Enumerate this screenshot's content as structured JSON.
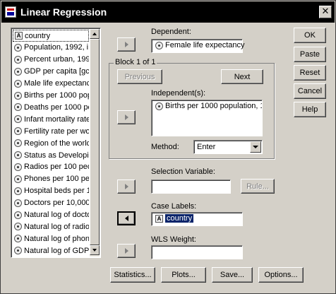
{
  "window": {
    "title": "Linear Regression",
    "close_glyph": "✕"
  },
  "variables": [
    {
      "label": "country",
      "type": "string"
    },
    {
      "label": "Population, 1992, i",
      "type": "scale"
    },
    {
      "label": "Percent urban, 199",
      "type": "scale"
    },
    {
      "label": "GDP per capita [gc",
      "type": "scale"
    },
    {
      "label": "Male life expectanc",
      "type": "scale"
    },
    {
      "label": "Births per 1000 pop",
      "type": "scale"
    },
    {
      "label": "Deaths per 1000 pe",
      "type": "scale"
    },
    {
      "label": "Infant mortality rate",
      "type": "scale"
    },
    {
      "label": "Fertility rate per wor",
      "type": "scale"
    },
    {
      "label": "Region of the world",
      "type": "scale"
    },
    {
      "label": "Status as Developi",
      "type": "scale"
    },
    {
      "label": "Radios per 100 peo",
      "type": "scale"
    },
    {
      "label": "Phones per 100 pe",
      "type": "scale"
    },
    {
      "label": "Hospital beds per 1",
      "type": "scale"
    },
    {
      "label": "Doctors per 10,000",
      "type": "scale"
    },
    {
      "label": "Natural log of docto",
      "type": "scale"
    },
    {
      "label": "Natural log of radio",
      "type": "scale"
    },
    {
      "label": "Natural log of phon",
      "type": "scale"
    },
    {
      "label": "Natural log of GDP",
      "type": "scale"
    }
  ],
  "dependent": {
    "label": "Dependent:",
    "value": "Female life expectancy"
  },
  "block": {
    "title": "Block 1 of 1",
    "previous_label": "Previous",
    "next_label": "Next",
    "independents_label": "Independent(s):",
    "independents": [
      "Births per 1000 population, 1"
    ],
    "method_label": "Method:",
    "method_value": "Enter"
  },
  "selection": {
    "label": "Selection Variable:",
    "value": "",
    "rule_label": "Rule..."
  },
  "case_labels": {
    "label": "Case Labels:",
    "value": "country"
  },
  "wls": {
    "label": "WLS Weight:",
    "value": ""
  },
  "buttons": {
    "ok": "OK",
    "paste": "Paste",
    "reset": "Reset",
    "cancel": "Cancel",
    "help": "Help"
  },
  "bottom_buttons": {
    "statistics": "Statistics...",
    "plots": "Plots...",
    "save": "Save...",
    "options": "Options..."
  },
  "icons": {
    "scale_var": "scale-variable-icon",
    "string_var": "string-variable-icon",
    "string_glyph": "A"
  }
}
